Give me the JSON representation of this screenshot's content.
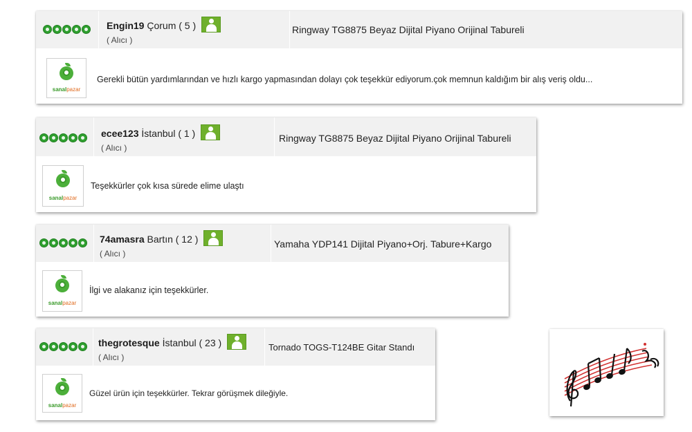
{
  "reviews": [
    {
      "username": "Engin19",
      "location_count": "Çorum ( 5 )",
      "role": "( Alıcı )",
      "product": "Ringway TG8875 Beyaz Dijital Piyano Orijinal Tabureli",
      "comment": "Gerekli bütün yardımlarından ve hızlı kargo yapmasından dolayı çok teşekkür ediyorum.çok memnun kaldığım bir alış veriş oldu...",
      "rating": 5
    },
    {
      "username": "ecee123",
      "location_count": "İstanbul ( 1 )",
      "role": "( Alıcı )",
      "product": "Ringway TG8875 Beyaz Dijital Piyano Orijinal Tabureli",
      "comment": "Teşekkürler çok kısa sürede elime ulaştı",
      "rating": 5
    },
    {
      "username": "74amasra",
      "location_count": "Bartın ( 12 )",
      "role": "( Alıcı )",
      "product": "Yamaha YDP141 Dijital Piyano+Orj. Tabure+Kargo",
      "comment": "İlgi ve alakanız için teşekkürler.",
      "rating": 5
    },
    {
      "username": "thegrotesque",
      "location_count": "İstanbul ( 23 )",
      "role": "( Alıcı )",
      "product": "Tornado TOGS-T124BE Gitar Standı",
      "comment": "Güzel ürün için teşekkürler. Tekrar görüşmek dileğiyle.",
      "rating": 5
    }
  ],
  "logo": {
    "brand_main": "sanal",
    "brand_accent": "pazar"
  },
  "colors": {
    "star_green": "#2f9f2f",
    "avatar_green": "#6fb02c",
    "header_bg": "#f1f1f1",
    "staff_red": "#d23030"
  },
  "icons": {
    "rating": "star-dot-icon",
    "avatar": "user-avatar-icon",
    "music": "music-notes-icon"
  }
}
